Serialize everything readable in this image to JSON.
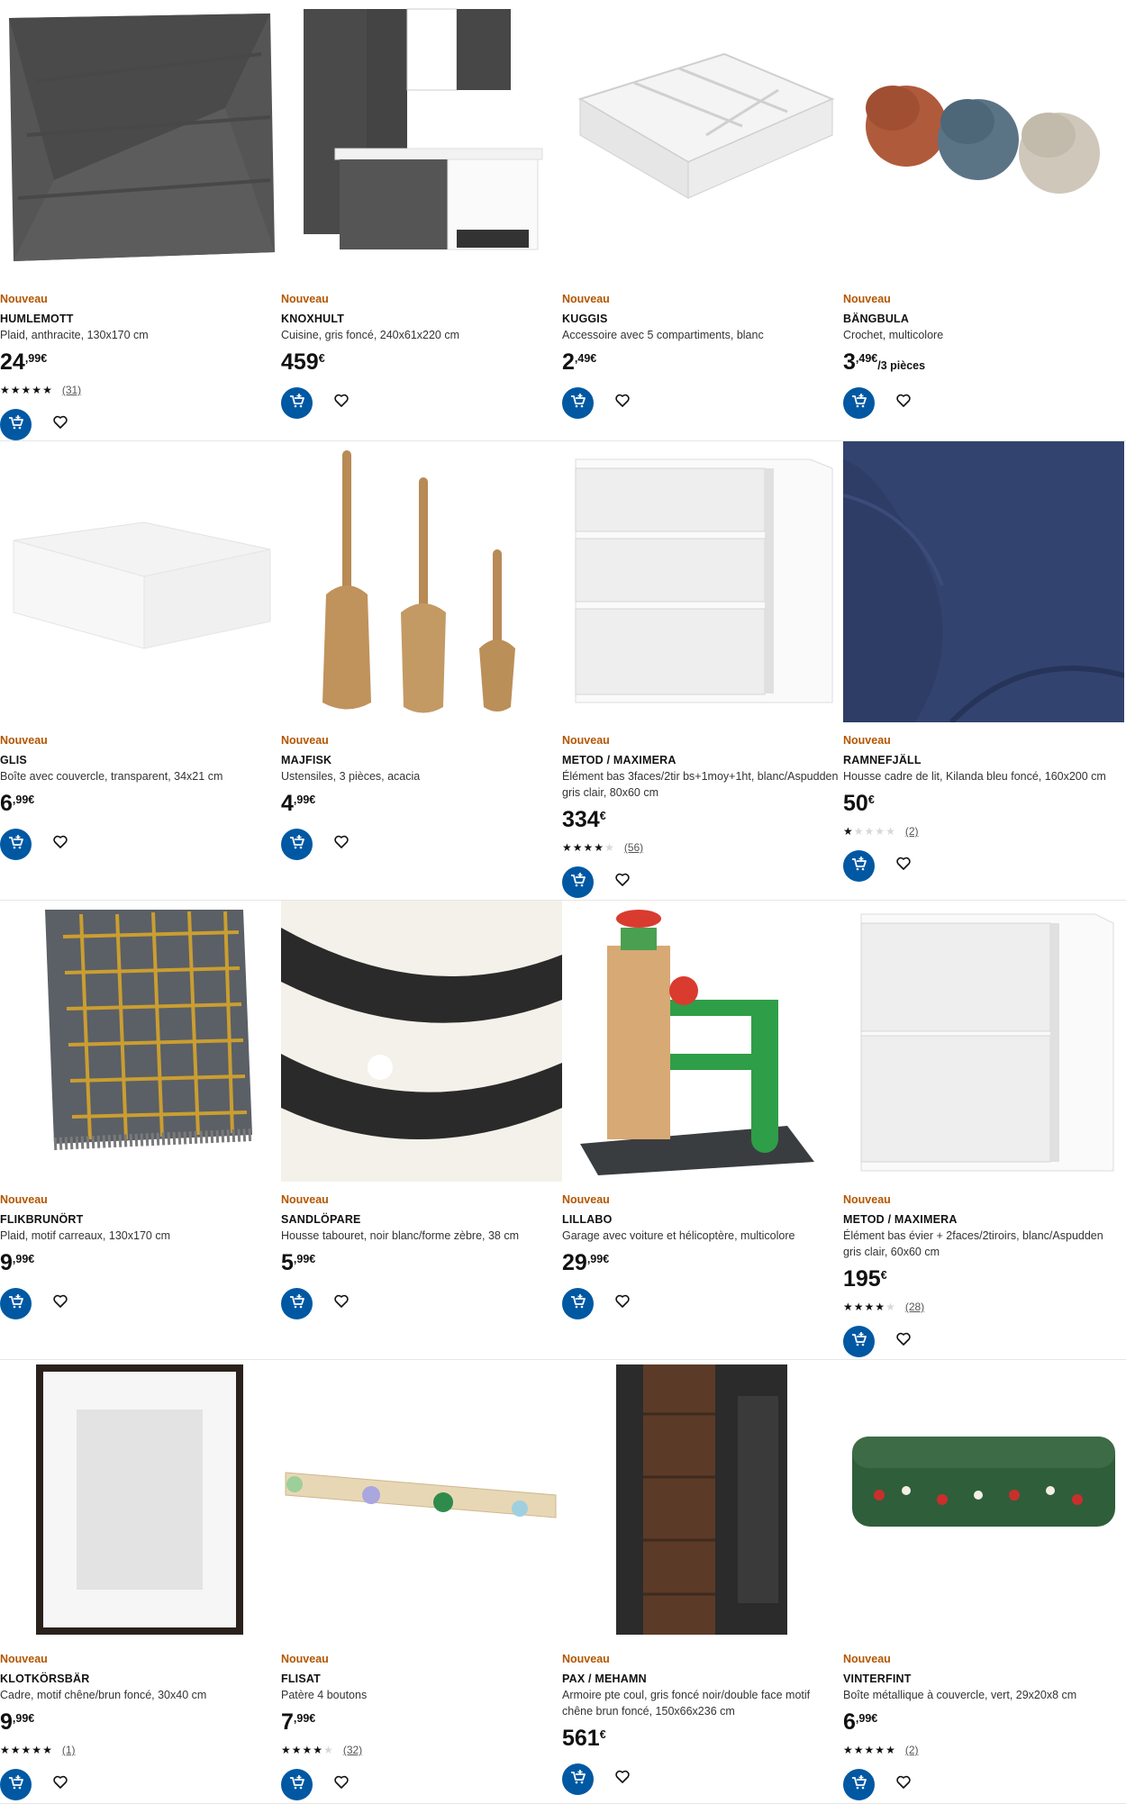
{
  "colors": {
    "accent": "#0058a3",
    "new_badge": "#b35600"
  },
  "icons": {
    "cart": "add-to-cart-icon",
    "favourite": "heart-icon",
    "star": "star-icon"
  },
  "products": [
    {
      "badge": "Nouveau",
      "name": "HUMLEMOTT",
      "desc": "Plaid, anthracite, 130x170 cm",
      "price_int": "24",
      "price_dec": ",99€",
      "unit": "",
      "rating": 5,
      "reviews": "(31)"
    },
    {
      "badge": "Nouveau",
      "name": "KNOXHULT",
      "desc": "Cuisine, gris foncé, 240x61x220 cm",
      "price_int": "459",
      "price_dec": "€",
      "unit": "",
      "rating": null,
      "reviews": ""
    },
    {
      "badge": "Nouveau",
      "name": "KUGGIS",
      "desc": "Accessoire avec 5 compartiments, blanc",
      "price_int": "2",
      "price_dec": ",49€",
      "unit": "",
      "rating": null,
      "reviews": ""
    },
    {
      "badge": "Nouveau",
      "name": "BÄNGBULA",
      "desc": "Crochet, multicolore",
      "price_int": "3",
      "price_dec": ",49€",
      "unit": "/3 pièces",
      "rating": null,
      "reviews": ""
    },
    {
      "badge": "Nouveau",
      "name": "GLIS",
      "desc": "Boîte avec couvercle, transparent, 34x21 cm",
      "price_int": "6",
      "price_dec": ",99€",
      "unit": "",
      "rating": null,
      "reviews": ""
    },
    {
      "badge": "Nouveau",
      "name": "MAJFISK",
      "desc": "Ustensiles, 3 pièces, acacia",
      "price_int": "4",
      "price_dec": ",99€",
      "unit": "",
      "rating": null,
      "reviews": ""
    },
    {
      "badge": "Nouveau",
      "name": "METOD / MAXIMERA",
      "desc": "Élément bas 3faces/2tir bs+1moy+1ht, blanc/Aspudden gris clair, 80x60 cm",
      "price_int": "334",
      "price_dec": "€",
      "unit": "",
      "rating": 4.5,
      "reviews": "(56)"
    },
    {
      "badge": "Nouveau",
      "name": "RAMNEFJÄLL",
      "desc": "Housse cadre de lit, Kilanda bleu foncé, 160x200 cm",
      "price_int": "50",
      "price_dec": "€",
      "unit": "",
      "rating": 1,
      "reviews": "(2)"
    },
    {
      "badge": "Nouveau",
      "name": "FLIKBRUNÖRT",
      "desc": "Plaid, motif carreaux, 130x170 cm",
      "price_int": "9",
      "price_dec": ",99€",
      "unit": "",
      "rating": null,
      "reviews": ""
    },
    {
      "badge": "Nouveau",
      "name": "SANDLÖPARE",
      "desc": "Housse tabouret, noir blanc/forme zèbre, 38 cm",
      "price_int": "5",
      "price_dec": ",99€",
      "unit": "",
      "rating": null,
      "reviews": ""
    },
    {
      "badge": "Nouveau",
      "name": "LILLABO",
      "desc": "Garage avec voiture et hélicoptère, multicolore",
      "price_int": "29",
      "price_dec": ",99€",
      "unit": "",
      "rating": null,
      "reviews": ""
    },
    {
      "badge": "Nouveau",
      "name": "METOD / MAXIMERA",
      "desc": "Élément bas évier + 2faces/2tiroirs, blanc/Aspudden gris clair, 60x60 cm",
      "price_int": "195",
      "price_dec": "€",
      "unit": "",
      "rating": 4.5,
      "reviews": "(28)"
    },
    {
      "badge": "Nouveau",
      "name": "KLOTKÖRSBÄR",
      "desc": "Cadre, motif chêne/brun foncé, 30x40 cm",
      "price_int": "9",
      "price_dec": ",99€",
      "unit": "",
      "rating": 5,
      "reviews": "(1)"
    },
    {
      "badge": "Nouveau",
      "name": "FLISAT",
      "desc": "Patère 4 boutons",
      "price_int": "7",
      "price_dec": ",99€",
      "unit": "",
      "rating": 4,
      "reviews": "(32)"
    },
    {
      "badge": "Nouveau",
      "name": "PAX / MEHAMN",
      "desc": "Armoire pte coul, gris foncé noir/double face motif chêne brun foncé, 150x66x236 cm",
      "price_int": "561",
      "price_dec": "€",
      "unit": "",
      "rating": null,
      "reviews": ""
    },
    {
      "badge": "Nouveau",
      "name": "VINTERFINT",
      "desc": "Boîte métallique à couvercle, vert, 29x20x8 cm",
      "price_int": "6",
      "price_dec": ",99€",
      "unit": "",
      "rating": 5,
      "reviews": "(2)"
    }
  ]
}
